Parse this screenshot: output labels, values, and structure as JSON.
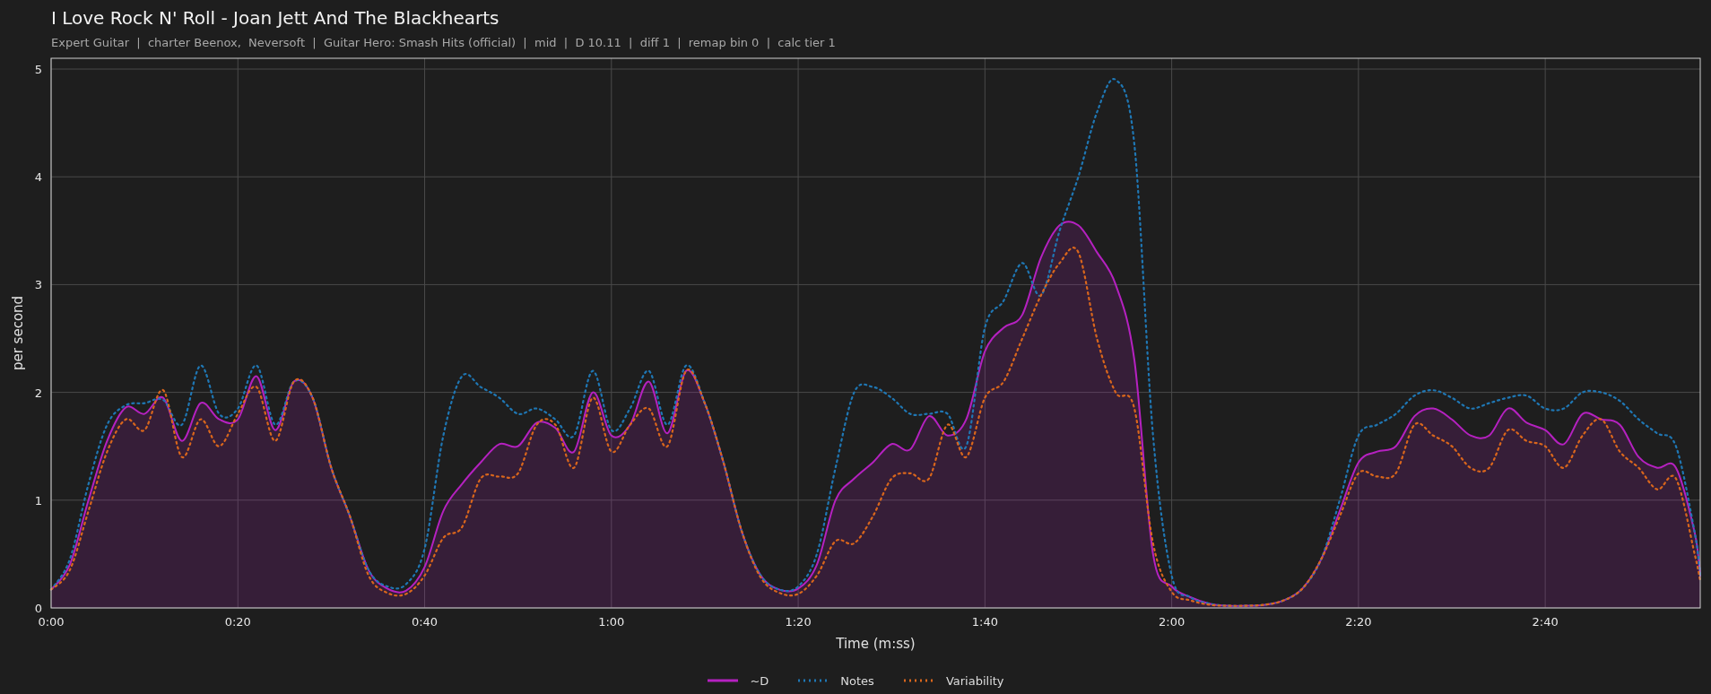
{
  "title": "I Love Rock N' Roll - Joan Jett And The Blackhearts",
  "subtitle": "Expert Guitar  |  charter Beenox,  Neversoft  |  Guitar Hero: Smash Hits (official)  |  mid  |  D 10.11  |  diff 1  |  remap bin 0  |  calc tier 1",
  "chart_data": {
    "type": "line",
    "xlabel": "Time (m:ss)",
    "ylabel": "per second",
    "xlim": [
      0,
      176.6
    ],
    "ylim": [
      0,
      5.1
    ],
    "xticks": [
      {
        "value": 0,
        "label": "0:00"
      },
      {
        "value": 20,
        "label": "0:20"
      },
      {
        "value": 40,
        "label": "0:40"
      },
      {
        "value": 60,
        "label": "1:00"
      },
      {
        "value": 80,
        "label": "1:20"
      },
      {
        "value": 100,
        "label": "1:40"
      },
      {
        "value": 120,
        "label": "2:00"
      },
      {
        "value": 140,
        "label": "2:20"
      },
      {
        "value": 160,
        "label": "2:40"
      }
    ],
    "yticks": [
      0,
      1,
      2,
      3,
      4,
      5
    ],
    "grid": true,
    "x": [
      0,
      2,
      4,
      6,
      8,
      10,
      12,
      14,
      16,
      18,
      20,
      22,
      24,
      26,
      28,
      30,
      32,
      34,
      36,
      38,
      40,
      42,
      44,
      46,
      48,
      50,
      52,
      54,
      56,
      58,
      60,
      62,
      64,
      66,
      68,
      70,
      72,
      74,
      76,
      78,
      80,
      82,
      84,
      86,
      88,
      90,
      92,
      94,
      96,
      98,
      100,
      102,
      104,
      106,
      108,
      110,
      112,
      114,
      116,
      118,
      120,
      122,
      124,
      126,
      128,
      130,
      132,
      134,
      136,
      138,
      140,
      142,
      144,
      146,
      148,
      150,
      152,
      154,
      156,
      158,
      160,
      162,
      164,
      166,
      168,
      170,
      172,
      174,
      176,
      176.6
    ],
    "series": [
      {
        "name": "~D",
        "color": "#b521c0",
        "type": "area",
        "line_style": "solid",
        "values": [
          0.17,
          0.4,
          1.0,
          1.55,
          1.86,
          1.8,
          1.95,
          1.55,
          1.9,
          1.75,
          1.75,
          2.15,
          1.65,
          2.1,
          1.95,
          1.3,
          0.85,
          0.35,
          0.18,
          0.16,
          0.38,
          0.9,
          1.15,
          1.35,
          1.52,
          1.5,
          1.72,
          1.67,
          1.45,
          2.0,
          1.6,
          1.7,
          2.1,
          1.62,
          2.2,
          1.9,
          1.35,
          0.7,
          0.3,
          0.17,
          0.18,
          0.4,
          1.0,
          1.2,
          1.35,
          1.52,
          1.47,
          1.78,
          1.6,
          1.75,
          2.38,
          2.6,
          2.72,
          3.25,
          3.55,
          3.55,
          3.3,
          3.0,
          2.3,
          0.5,
          0.2,
          0.1,
          0.04,
          0.02,
          0.02,
          0.03,
          0.07,
          0.18,
          0.45,
          0.9,
          1.35,
          1.45,
          1.5,
          1.78,
          1.85,
          1.75,
          1.6,
          1.6,
          1.85,
          1.72,
          1.65,
          1.52,
          1.8,
          1.75,
          1.7,
          1.4,
          1.3,
          1.3,
          0.7,
          0.3
        ]
      },
      {
        "name": "Notes",
        "color": "#1f77b4",
        "type": "line",
        "line_style": "dotted",
        "values": [
          0.17,
          0.45,
          1.15,
          1.7,
          1.88,
          1.9,
          1.93,
          1.7,
          2.25,
          1.8,
          1.85,
          2.25,
          1.7,
          2.1,
          1.95,
          1.3,
          0.85,
          0.35,
          0.2,
          0.22,
          0.55,
          1.6,
          2.15,
          2.05,
          1.95,
          1.8,
          1.85,
          1.75,
          1.6,
          2.2,
          1.65,
          1.85,
          2.2,
          1.7,
          2.25,
          1.9,
          1.35,
          0.7,
          0.3,
          0.17,
          0.2,
          0.5,
          1.3,
          2.0,
          2.05,
          1.95,
          1.8,
          1.8,
          1.8,
          1.5,
          2.6,
          2.85,
          3.2,
          2.9,
          3.5,
          4.0,
          4.6,
          4.9,
          4.3,
          1.6,
          0.3,
          0.1,
          0.04,
          0.02,
          0.02,
          0.03,
          0.07,
          0.18,
          0.45,
          1.0,
          1.6,
          1.7,
          1.8,
          1.97,
          2.02,
          1.95,
          1.85,
          1.9,
          1.95,
          1.97,
          1.85,
          1.85,
          2.0,
          2.0,
          1.92,
          1.75,
          1.62,
          1.5,
          0.7,
          0.3
        ]
      },
      {
        "name": "Variability",
        "color": "#d9661c",
        "type": "line",
        "line_style": "dotted",
        "values": [
          0.17,
          0.35,
          0.9,
          1.45,
          1.75,
          1.65,
          2.02,
          1.4,
          1.75,
          1.5,
          1.8,
          2.05,
          1.55,
          2.1,
          1.95,
          1.3,
          0.85,
          0.3,
          0.14,
          0.13,
          0.3,
          0.65,
          0.75,
          1.2,
          1.22,
          1.25,
          1.7,
          1.7,
          1.3,
          1.95,
          1.45,
          1.7,
          1.85,
          1.5,
          2.2,
          1.9,
          1.35,
          0.7,
          0.28,
          0.14,
          0.13,
          0.3,
          0.62,
          0.6,
          0.85,
          1.2,
          1.25,
          1.2,
          1.7,
          1.4,
          1.95,
          2.1,
          2.5,
          2.9,
          3.2,
          3.3,
          2.5,
          2.0,
          1.85,
          0.6,
          0.15,
          0.07,
          0.03,
          0.02,
          0.02,
          0.03,
          0.07,
          0.18,
          0.45,
          0.85,
          1.25,
          1.22,
          1.25,
          1.7,
          1.6,
          1.5,
          1.3,
          1.3,
          1.65,
          1.55,
          1.5,
          1.3,
          1.6,
          1.75,
          1.45,
          1.3,
          1.1,
          1.2,
          0.5,
          0.25
        ]
      }
    ]
  }
}
